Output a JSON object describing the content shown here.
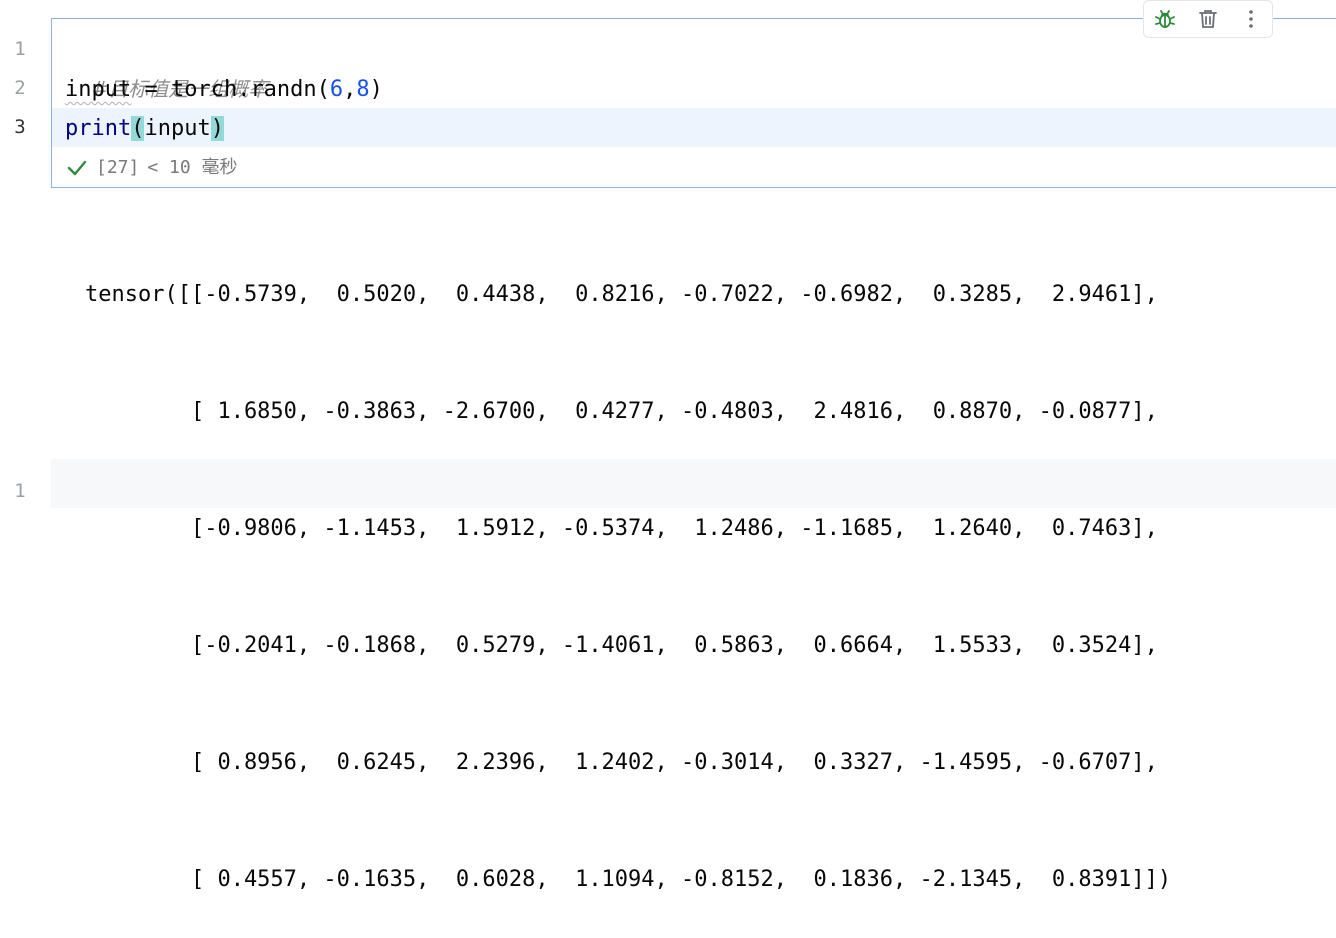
{
  "cell": {
    "line_numbers": [
      "1",
      "2",
      "3"
    ],
    "code": {
      "line1_comment": "#目标值是一组概率",
      "line2": {
        "var": "input",
        "mid": " = torch.randn(",
        "num1": "6",
        "comma": ",",
        "num2": "8",
        "close": ")"
      },
      "line3": {
        "fn": "print",
        "open": "(",
        "arg": "input",
        "close": ")"
      }
    },
    "status": {
      "exec_count": "[27]",
      "duration": "< 10 毫秒"
    }
  },
  "toolbar": {
    "debug_icon": "bug-icon",
    "delete_icon": "trash-icon",
    "more_icon": "more-vertical-icon"
  },
  "output": {
    "lines": [
      "tensor([[-0.5739,  0.5020,  0.4438,  0.8216, -0.7022, -0.6982,  0.3285,  2.9461],",
      "        [ 1.6850, -0.3863, -2.6700,  0.4277, -0.4803,  2.4816,  0.8870, -0.0877],",
      "        [-0.9806, -1.1453,  1.5912, -0.5374,  1.2486, -1.1685,  1.2640,  0.7463],",
      "        [-0.2041, -0.1868,  0.5279, -1.4061,  0.5863,  0.6664,  1.5533,  0.3524],",
      "        [ 0.8956,  0.6245,  2.2396,  1.2402, -0.3014,  0.3327, -1.4595, -0.6707],",
      "        [ 0.4557, -0.1635,  0.6028,  1.1094, -0.8152,  0.1836, -2.1345,  0.8391]])"
    ]
  },
  "next_cell": {
    "line_numbers": [
      "1"
    ]
  },
  "colors": {
    "accent_border": "#8fb0e0",
    "success": "#2e8b3e",
    "number": "#1750eb",
    "paren_match": "#93d9d9"
  }
}
